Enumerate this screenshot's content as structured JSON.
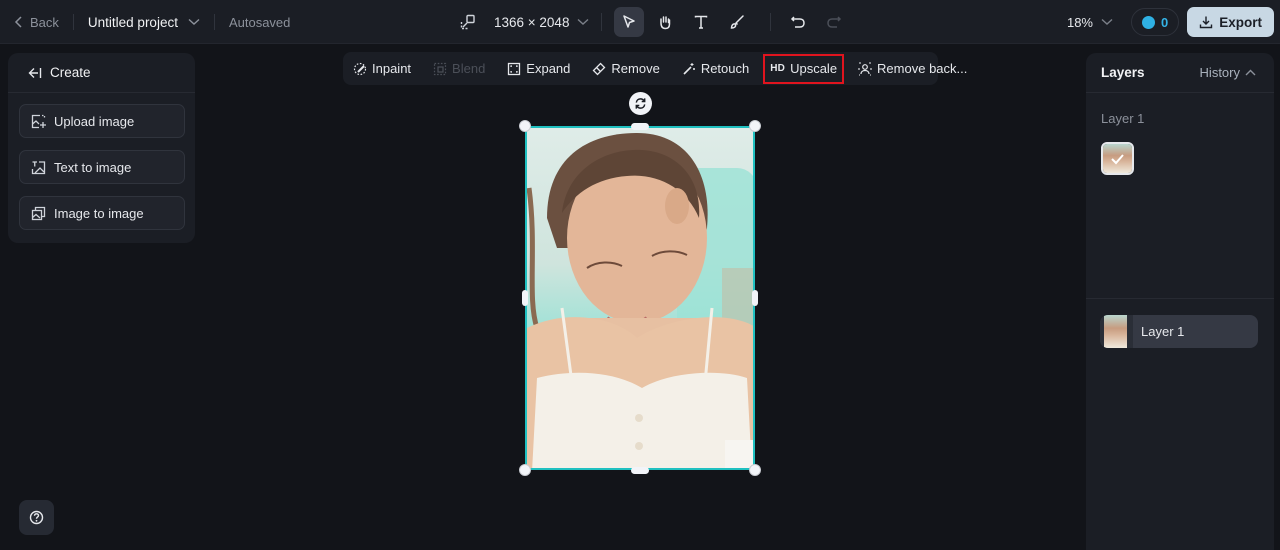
{
  "topbar": {
    "back_label": "Back",
    "project_name": "Untitled project",
    "save_status": "Autosaved",
    "canvas_size": "1366 × 2048",
    "zoom_level": "18%",
    "credits": "0",
    "export_label": "Export",
    "tools": [
      {
        "name": "select",
        "icon": "cursor-icon",
        "active": true
      },
      {
        "name": "hand",
        "icon": "hand-icon",
        "active": false
      },
      {
        "name": "text",
        "icon": "text-icon",
        "active": false
      },
      {
        "name": "brush",
        "icon": "brush-icon",
        "active": false
      }
    ],
    "undo_enabled": true,
    "redo_enabled": false
  },
  "create_panel": {
    "title": "Create",
    "buttons": [
      {
        "label": "Upload image",
        "icon": "upload-image-icon"
      },
      {
        "label": "Text to image",
        "icon": "text-to-image-icon"
      },
      {
        "label": "Image to image",
        "icon": "image-to-image-icon"
      }
    ]
  },
  "edit_toolbar": {
    "items": [
      {
        "label": "Inpaint",
        "icon": "inpaint-icon",
        "enabled": true
      },
      {
        "label": "Blend",
        "icon": "blend-icon",
        "enabled": false
      },
      {
        "label": "Expand",
        "icon": "expand-icon",
        "enabled": true
      },
      {
        "label": "Remove",
        "icon": "eraser-icon",
        "enabled": true
      },
      {
        "label": "Retouch",
        "icon": "retouch-icon",
        "enabled": true
      },
      {
        "label": "Upscale",
        "icon_text": "HD",
        "enabled": true,
        "highlighted": true
      },
      {
        "label": "Remove back...",
        "icon": "remove-background-icon",
        "enabled": true
      }
    ]
  },
  "layers_panel": {
    "title": "Layers",
    "history_label": "History",
    "group_label": "Layer 1",
    "layers": [
      {
        "label": "Layer 1",
        "selected": true
      }
    ]
  },
  "colors": {
    "accent_selection": "#1fc0c0",
    "highlight_box": "#e0141e",
    "credits": "#34b3e6",
    "export_bg": "#c8d8e4"
  }
}
